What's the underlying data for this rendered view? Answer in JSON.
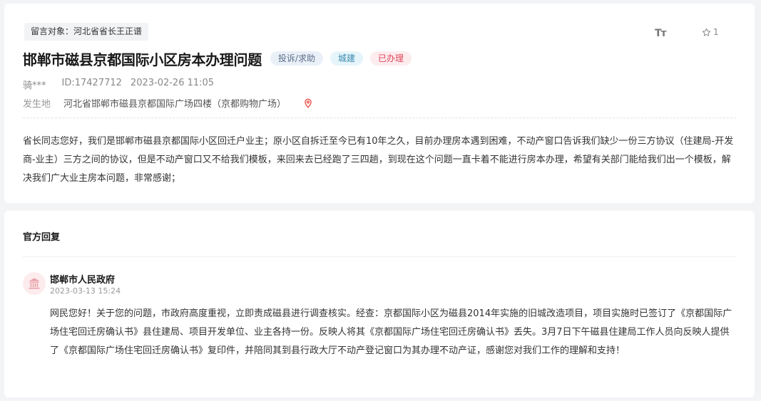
{
  "post": {
    "target": "留言对象：河北省省长王正谱",
    "title": "邯郸市磁县京都国际小区房本办理问题",
    "tags": {
      "type": "投诉/求助",
      "category": "城建",
      "status": "已办理"
    },
    "font_size_label": "Tт",
    "favorite_count": "1",
    "author": "骑***",
    "id": "ID:17427712",
    "time": "2023-02-26 11:05",
    "location_label": "发生地",
    "location": "河北省邯郸市磁县京都国际广场四楼（京都购物广场）",
    "content": "省长同志您好，我们是邯郸市磁县京都国际小区回迁户业主；原小区自拆迁至今已有10年之久，目前办理房本遇到困难，不动产窗口告诉我们缺少一份三方协议（住建局-开发商-业主）三方之间的协议，但是不动产窗口又不给我们模板，来回来去已经跑了三四趟，到现在这个问题一直卡着不能进行房本办理，希望有关部门能给我们出一个模板，解决我们广大业主房本问题，非常感谢；"
  },
  "reply": {
    "heading": "官方回复",
    "org": "邯郸市人民政府",
    "time": "2023-03-13 15:24",
    "content": "网民您好！关于您的问题，市政府高度重视，立即责成磁县进行调查核实。经查：京都国际小区为磁县2014年实施的旧城改造项目，项目实施时已签订了《京都国际广场住宅回迁房确认书》县住建局、项目开发单位、业主各持一份。反映人将其《京都国际广场住宅回迁房确认书》丢失。3月7日下午磁县住建局工作人员向反映人提供了《京都国际广场住宅回迁房确认书》复印件，并陪同其到县行政大厅不动产登记窗口为其办理不动产证，感谢您对我们工作的理解和支持！"
  },
  "colors": {
    "status_red": "#e0445a",
    "pin_red": "#e8453c",
    "avatar_bg": "#fdecee"
  },
  "icons": {
    "font_size": "font-size-icon",
    "favorite": "star-outline-icon",
    "location": "location-pin-icon",
    "avatar": "government-building-icon"
  }
}
